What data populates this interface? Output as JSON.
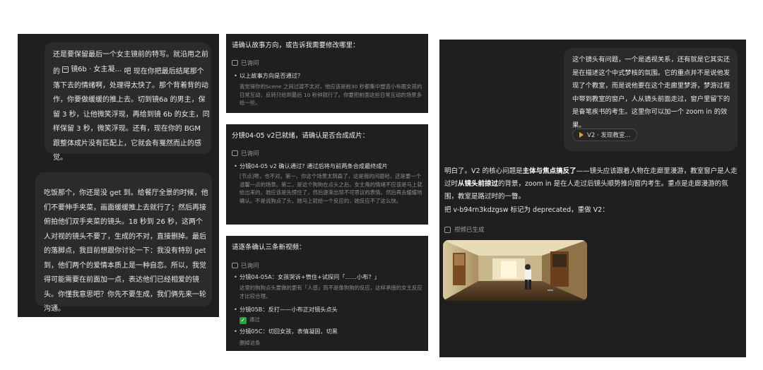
{
  "panel1": {
    "text_before_chip": "还是要保留最后一个女主镜前的特写。就沿用之前的",
    "chip_label": "镜6b · 女主凝…",
    "text_after_chip": "吧 现在你把最后结尾那个落下去的情绪啊，处理得太快了。那个背着背的动作，你要做缓缓的推上去。切到镜6a 的男主，保留 3 秒，让他微笑浮现，再给到镜 6b 的女主，同样保留 3 秒，微笑浮现。还有，现在你的 BGM 跟整体成片没有匹配上，它就会有戛然而止的感觉。"
  },
  "panel2": {
    "text": "吃饭那个，你还是没 get 到。给餐厅全景的时候，他们不要伸手夹菜，画面缓缓推上去就行了；然后再接俯拍他们双手夹菜的镜头。18 秒到 26 秒，这两个人对视的镜头不要了，生成的不对，直接删掉。最后的落脚点，我目前想跟你讨论一下：我没有特别 get 到，他们两个的爱情本质上是一种自恋。所以，我觉得可能需要在前面加一点，表达他们已经相爱的镜头。你懂我意思吧？你先不要生成，我们俩先来一轮沟通。"
  },
  "panel3": {
    "title": "请确认故事方向，或告诉我需要修改哪里：",
    "inquired": "已询问",
    "item": "以上故事方向是否通过？",
    "note": "我觉得你的Scene 之间过渡不太对，他应该是前30 秒都集中塑造小布跟女孩的日常互动，反转只给到最后 10 秒钟就行了。你要把前面这些日常互动的场景多给一些。"
  },
  "panel4": {
    "title": "分镜04-05 v2已就绪，请确认是否合成成片：",
    "inquired": "已询问",
    "item": "分镜04-05 v2 确认通过? 通过后将与前两条合成最终成片",
    "note": "[节点]嗯，也不对。第一，你这个场景太阴森了，这是我的问题哈，还是要一个温馨一点的场景。第二，是这个狗狗在点头之后，女主角的情绪不应该是马上就给出来的，她应该是先愣住了，然后逐渐出现不可思议的表情，然后再去缓缓地确认。不是说狗点了头，她马上就给一个反应的，她反应不了这么快。"
  },
  "panel5": {
    "title": "请逐条确认三条新视频：",
    "inquired": "已询问",
    "items": [
      {
        "label": "分镜04-05A：女孩哭诉+愤住+试探问「……小布？」",
        "note": "这里的狗狗点头要做的更有「人感」而不是像狗狗的反应，这样承接的女主反应才比较合理。"
      },
      {
        "label": "分镜05B：反打——小布正对镜头点头",
        "note": "通过"
      },
      {
        "label": "分镜05C：切回女孩，表情凝固，切黑",
        "note": "删掉这条"
      }
    ]
  },
  "panel6": {
    "user_message": "这个镜头有问题，一个是透视关系，还有就是它其实还是在描述这个中式梦核的氛围。它的重点并不是说他发现了个教室，而是说他要在这个走廊里梦游，梦游过程中带到教室的窗户，人从镜头前面走过，窗户里留下的是奋笔疾书的考生。这里你可以加一个 zoom in 的效果。",
    "ref_chip": "V2 · 发现教室...",
    "reply_p1_before": "明白了。V2 的核心问题是",
    "reply_p1_bold1": "主体与焦点搞反了",
    "reply_p1_mid": "——镜头应该跟着人物在走廊里漫游，教室窗户是人走过时",
    "reply_p1_bold2": "从镜头前掠过",
    "reply_p1_after": "的背景，zoom in 是在人走过后镜头顺势推向窗内考生。重点是走廊漫游的氛围，教室是路过时的一瞥。",
    "reply_p2": "把 v-b94rn3kdzgsw 标记为 deprecated，重做 V2：",
    "generated_label": "视频已生成"
  },
  "colors": {
    "panel_bg": "#1f1f1f",
    "bubble_bg": "#2b2b2b",
    "accent_check": "#2ea043"
  }
}
